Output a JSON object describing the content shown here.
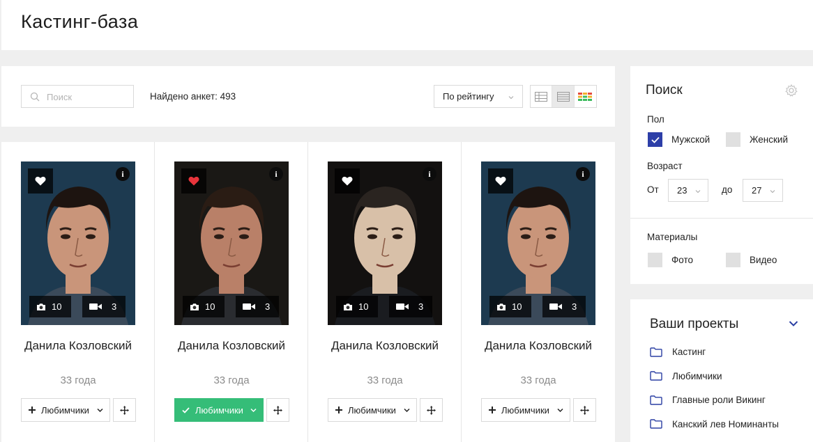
{
  "header": {
    "title": "Кастинг-база"
  },
  "toolbar": {
    "search_placeholder": "Поиск",
    "found_text": "Найдено анкет: 493",
    "sort_value": "По рейтингу",
    "view_modes": [
      "table-view-icon",
      "list-view-icon",
      "color-view-icon"
    ],
    "active_view": 1
  },
  "cards": [
    {
      "name": "Данила Козловский",
      "age": "33 года",
      "photos": "10",
      "videos": "3",
      "favorite": false,
      "list_label": "Любимчики",
      "in_list": false
    },
    {
      "name": "Данила Козловский",
      "age": "33 года",
      "photos": "10",
      "videos": "3",
      "favorite": true,
      "list_label": "Любимчики",
      "in_list": true
    },
    {
      "name": "Данила Козловский",
      "age": "33 года",
      "photos": "10",
      "videos": "3",
      "favorite": false,
      "list_label": "Любимчики",
      "in_list": false
    },
    {
      "name": "Данила Козловский",
      "age": "33 года",
      "photos": "10",
      "videos": "3",
      "favorite": false,
      "list_label": "Любимчики",
      "in_list": false
    }
  ],
  "filter": {
    "title": "Поиск",
    "gender_label": "Пол",
    "gender_male": "Мужской",
    "gender_female": "Женский",
    "male_checked": true,
    "female_checked": false,
    "age_label": "Возраст",
    "age_from_label": "От",
    "age_from": "23",
    "age_to_label": "до",
    "age_to": "27",
    "materials_label": "Материалы",
    "material_photo": "Фото",
    "material_video": "Видео"
  },
  "projects": {
    "title": "Ваши проекты",
    "items": [
      "Кастинг",
      "Любимчики",
      "Главные роли Викинг",
      "Канский лев Номинанты"
    ]
  },
  "colors": {
    "accent_green": "#35bd78",
    "checkbox_blue": "#2d3fa8",
    "heart_red": "#e8343b",
    "folder_blue": "#2a3fa3"
  }
}
